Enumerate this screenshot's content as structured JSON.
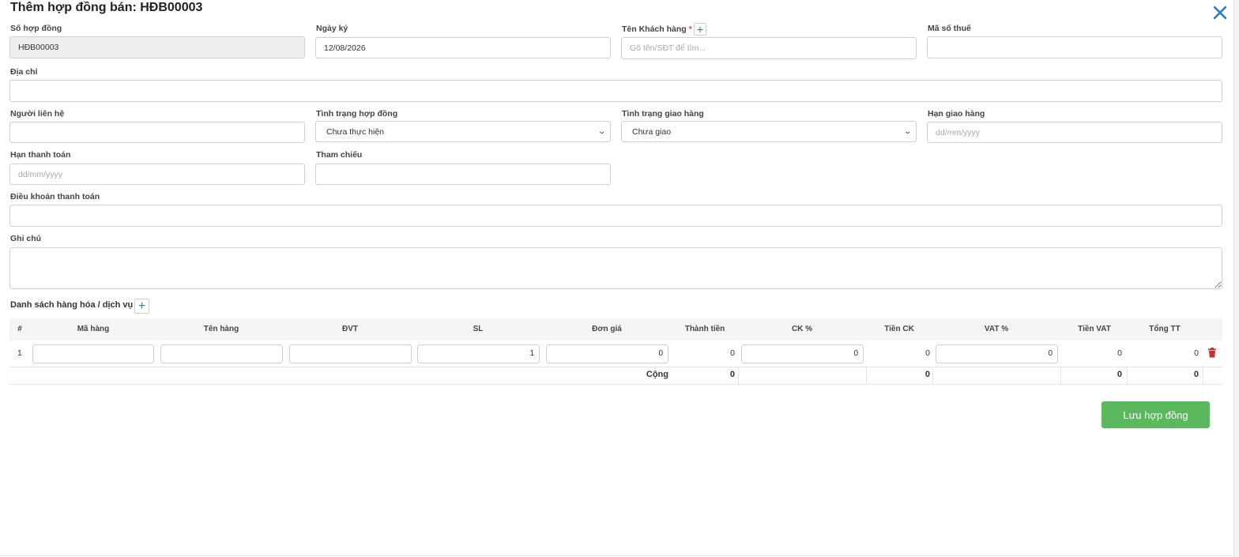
{
  "header": {
    "title": "Thêm hợp đồng bán: HĐB00003",
    "close_icon": "close-icon"
  },
  "form": {
    "contract_no": {
      "label": "Số hợp đồng",
      "value": "HĐB00003"
    },
    "sign_date": {
      "label": "Ngày ký",
      "value": "12/08/2026"
    },
    "customer": {
      "label": "Tên Khách hàng",
      "required_mark": "*",
      "add_label": "+",
      "placeholder": "Gõ tên/SĐT để tìm..."
    },
    "tax_code": {
      "label": "Mã số thuế",
      "value": ""
    },
    "address": {
      "label": "Địa chỉ",
      "value": ""
    },
    "contact": {
      "label": "Người liên hệ",
      "value": ""
    },
    "contract_status": {
      "label": "Tình trạng hợp đồng",
      "value": "Chưa thực hiện"
    },
    "delivery_status": {
      "label": "Tình trạng giao hàng",
      "value": "Chưa giao"
    },
    "delivery_deadline": {
      "label": "Hạn giao hàng",
      "placeholder": "dd/mm/yyyy"
    },
    "payment_deadline": {
      "label": "Hạn thanh toán",
      "placeholder": "dd/mm/yyyy"
    },
    "reference": {
      "label": "Tham chiếu",
      "value": ""
    },
    "payment_terms": {
      "label": "Điều khoản thanh toán",
      "value": ""
    },
    "notes": {
      "label": "Ghi chú",
      "value": ""
    }
  },
  "items": {
    "title": "Danh sách hàng hóa / dịch vụ",
    "add_label": "+",
    "columns": [
      "#",
      "Mã hàng",
      "Tên hàng",
      "ĐVT",
      "SL",
      "Đơn giá",
      "Thành tiền",
      "CK %",
      "Tiền CK",
      "VAT %",
      "Tiền VAT",
      "Tổng TT"
    ],
    "rows": [
      {
        "index": "1",
        "code": "",
        "name": "",
        "unit": "",
        "qty": "1",
        "price": "0",
        "amount": "0",
        "discount_pct": "0",
        "discount_amount": "0",
        "vat_pct": "0",
        "vat_amount": "0",
        "total": "0"
      }
    ],
    "totals": {
      "label": "Cộng",
      "amount": "0",
      "discount_amount": "0",
      "vat_amount": "0",
      "total": "0"
    }
  },
  "actions": {
    "save_label": "Lưu hợp đồng"
  },
  "colors": {
    "accent": "#2a7ab8",
    "save": "#5cb85c",
    "delete": "#c9302c",
    "header_bg": "#f4f6f5"
  }
}
